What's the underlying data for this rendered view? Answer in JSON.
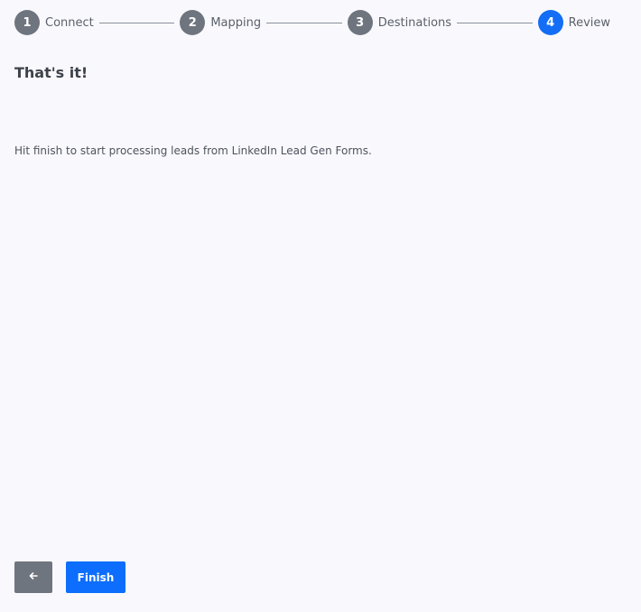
{
  "stepper": {
    "steps": [
      {
        "number": "1",
        "label": "Connect",
        "state": "completed"
      },
      {
        "number": "2",
        "label": "Mapping",
        "state": "completed"
      },
      {
        "number": "3",
        "label": "Destinations",
        "state": "completed"
      },
      {
        "number": "4",
        "label": "Review",
        "state": "active"
      }
    ]
  },
  "content": {
    "title": "That's it!",
    "description": "Hit finish to start processing leads from LinkedIn Lead Gen Forms."
  },
  "footer": {
    "back_icon": "arrow-left-icon",
    "finish_label": "Finish"
  },
  "colors": {
    "primary": "#0d6efd",
    "step_inactive": "#6f757f",
    "background": "#f9f9fd"
  }
}
